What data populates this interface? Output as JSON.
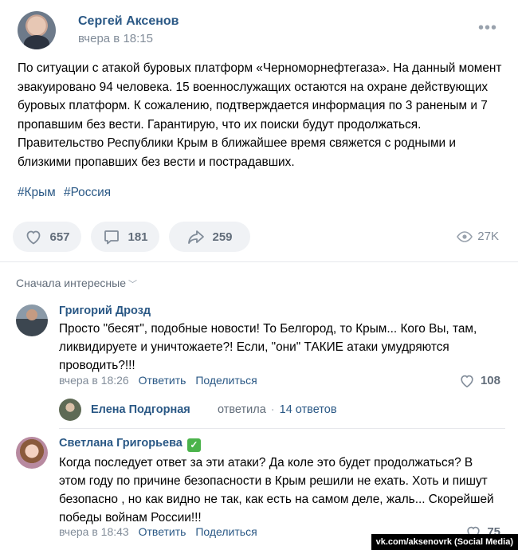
{
  "post": {
    "author": "Сергей Аксенов",
    "time": "вчера в 18:15",
    "text": "По ситуации с атакой буровых платформ «Черноморнефтегаза». На данный момент эвакуировано 94 человека. 15 военнослужащих остаются на охране действующих буровых платформ. К сожалению, подтверждается информация по 3 раненым и 7 пропавшим без вести. Гарантирую, что их поиски будут продолжаться. Правительство Республики Крым в ближайшее время свяжется с родными и близкими пропавших без вести и пострадавших.",
    "tags": [
      "#Крым",
      "#Россия"
    ],
    "likes": "657",
    "comments": "181",
    "shares": "259",
    "views": "27K"
  },
  "sort_label": "Сначала интересные",
  "comments": [
    {
      "name": "Григорий Дрозд",
      "text": "Просто \"бесят\", подобные новости! То Белгород, то Крым... Кого Вы, там, ликвидируете и уничтожаете?! Если, \"они\" ТАКИЕ атаки умудряются проводить?!!!",
      "time": "вчера в 18:26",
      "reply": "Ответить",
      "share": "Поделиться",
      "likes": "108"
    },
    {
      "name": "Светлана Григорьева",
      "text": "Когда последует ответ за эти атаки? Да коле это будет продолжаться? В этом году по причине безопасности в Крым решили не ехать. Хоть и пишут безопасно , но как видно не так, как есть на самом деле, жаль... Скорейшей победы войнам России!!!",
      "time": "вчера в 18:43",
      "reply": "Ответить",
      "share": "Поделиться",
      "likes": "75"
    }
  ],
  "thread": {
    "name": "Елена Подгорная",
    "action": "ответила",
    "replies": "14 ответов"
  },
  "watermark": "vk.com/aksenovrk (Social Media)",
  "colors": {
    "link": "#2a5885",
    "muted": "#818c99",
    "button_bg": "#f0f2f5",
    "verified": "#4bb34b"
  }
}
